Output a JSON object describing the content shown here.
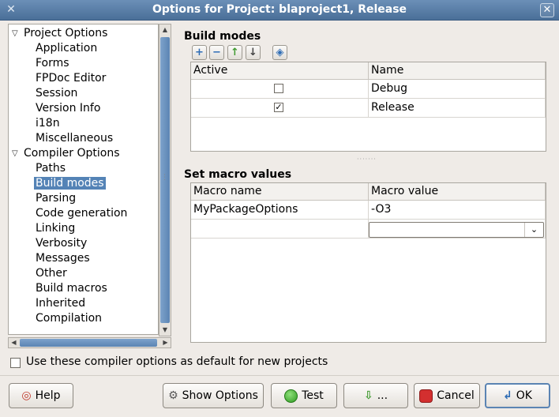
{
  "window": {
    "title": "Options for Project: blaproject1, Release"
  },
  "tree": [
    {
      "label": "Project Options",
      "level": 0,
      "expanded": true,
      "selected": false
    },
    {
      "label": "Application",
      "level": 1,
      "selected": false
    },
    {
      "label": "Forms",
      "level": 1,
      "selected": false
    },
    {
      "label": "FPDoc Editor",
      "level": 1,
      "selected": false
    },
    {
      "label": "Session",
      "level": 1,
      "selected": false
    },
    {
      "label": "Version Info",
      "level": 1,
      "selected": false
    },
    {
      "label": "i18n",
      "level": 1,
      "selected": false
    },
    {
      "label": "Miscellaneous",
      "level": 1,
      "selected": false
    },
    {
      "label": "Compiler Options",
      "level": 0,
      "expanded": true,
      "selected": false
    },
    {
      "label": "Paths",
      "level": 1,
      "selected": false
    },
    {
      "label": "Build modes",
      "level": 1,
      "selected": true
    },
    {
      "label": "Parsing",
      "level": 1,
      "selected": false
    },
    {
      "label": "Code generation",
      "level": 1,
      "selected": false
    },
    {
      "label": "Linking",
      "level": 1,
      "selected": false
    },
    {
      "label": "Verbosity",
      "level": 1,
      "selected": false
    },
    {
      "label": "Messages",
      "level": 1,
      "selected": false
    },
    {
      "label": "Other",
      "level": 1,
      "selected": false
    },
    {
      "label": "Build macros",
      "level": 1,
      "selected": false
    },
    {
      "label": "Inherited",
      "level": 1,
      "selected": false
    },
    {
      "label": "Compilation",
      "level": 1,
      "selected": false
    }
  ],
  "build_modes": {
    "title": "Build modes",
    "toolbar": [
      "add-icon",
      "remove-icon",
      "move-up-icon",
      "move-down-icon",
      "diff-icon"
    ],
    "columns": [
      "Active",
      "Name"
    ],
    "rows": [
      {
        "active": false,
        "name": "Debug"
      },
      {
        "active": true,
        "name": "Release"
      }
    ]
  },
  "macros": {
    "title": "Set macro values",
    "columns": [
      "Macro name",
      "Macro value"
    ],
    "rows": [
      {
        "name": "MyPackageOptions",
        "value": "-O3"
      }
    ],
    "combo_value": ""
  },
  "default_option": {
    "label": "Use these compiler options as default for new projects",
    "checked": false
  },
  "buttons": {
    "help": "Help",
    "show_options": "Show Options",
    "test": "Test",
    "export": "...",
    "cancel": "Cancel",
    "ok": "OK"
  },
  "colors": {
    "selection": "#5483b6",
    "title_bar": "#5a7fa8"
  }
}
